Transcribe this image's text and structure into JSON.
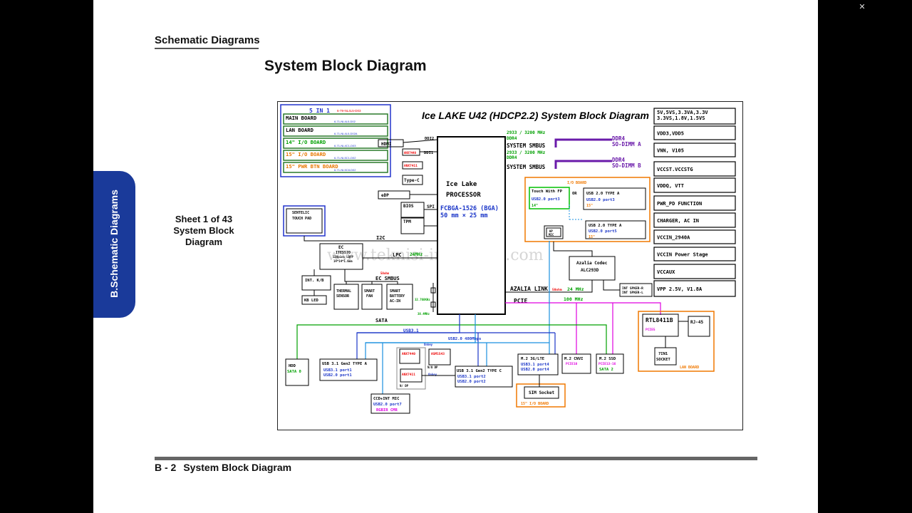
{
  "viewer": {
    "close_icon": "close-icon"
  },
  "header": {
    "section_title": "Schematic  Diagrams",
    "page_title": "System Block Diagram"
  },
  "side_tab": {
    "label": "B.Schematic Diagrams"
  },
  "sheet": {
    "line1": "Sheet 1 of 43",
    "line2": "System Block",
    "line3": "Diagram"
  },
  "footer": {
    "page_number": "B - 2",
    "title": "System Block Diagram"
  },
  "diagram": {
    "title": "Ice LAKE U42 (HDCP2.2) System Block Diagram",
    "watermark": "www.teknisi-indonesia.com",
    "boards_group": {
      "title": "5 IN 1",
      "title_pn": "6-79-NL4L5-D03",
      "rows": [
        {
          "label": "MAIN BOARD",
          "pn": "6-71-NL4L0-D02",
          "color": "#000000"
        },
        {
          "label": "LAN BOARD",
          "pn": "6-71-NL4L0-D02A",
          "color": "#000000"
        },
        {
          "label": "14\" I/O BOARD",
          "pn": "6-71-NL4C1-D03",
          "color": "#00a000"
        },
        {
          "label": "15\" I/O BOARD",
          "pn": "6-71-NL5C1-D02",
          "color": "#e87800"
        },
        {
          "label": "15\" PWR BTN BOARD",
          "pn": "6-71-NL5C8-D02",
          "color": "#e87800"
        }
      ]
    },
    "cpu": {
      "line1": "Ice Lake",
      "line2": "PROCESSOR",
      "line3": "FCBGA-1526 (BGA)",
      "line4": "50 mm × 25 mm"
    },
    "left_blocks": {
      "hdmi": "HDMI",
      "ddi2": "DDI2",
      "anx7440_small": "ANX7440",
      "ddi1": "DDI1",
      "anx7411": "ANX7411",
      "typec": "Type-C",
      "edp": "eDP",
      "bios": "BIOS",
      "spi": "SPI",
      "tpm": "TPM",
      "touchpad1": "SENTELIC",
      "touchpad2": "TOUCH PAD",
      "i2c": "I2C",
      "ec1": "EC",
      "ec2": "ITE5570",
      "ec3": "128pins LQFP",
      "ec4": "14*14*1.6mm",
      "lpc": "LPC",
      "lpc_freq": "24MHz",
      "ec_smbus": "EC SMBUS",
      "ec_smbus_small": "50ohm",
      "intkb": "INT. K/B",
      "kbled": "KB LED",
      "thermal1": "THERMAL",
      "thermal2": "SENSOR",
      "fan1": "SMART",
      "fan2": "FAN",
      "battery1": "SMART",
      "battery2": "BATTERY",
      "battery3": "AC-IN",
      "xtal1": "32.768KHz",
      "xtal2": "38.4MHz"
    },
    "memory": {
      "freq1": "2933 / 3200 MHz",
      "ddr_a_left": "DDR4",
      "smbus_a": "SYSTEM SMBUS",
      "freq2": "2933 / 3200 MHz",
      "ddr_b_left": "DDR4",
      "smbus_b": "SYSTEM SMBUS",
      "dimm_a1": "DDR4",
      "dimm_a2": "SO-DIMM A",
      "dimm_b1": "DDR4",
      "dimm_b2": "SO-DIMM B"
    },
    "io_board": {
      "title": "I/O BOARD",
      "fp1": "Touch With FP",
      "fp2": "USB2.0 port3",
      "fp3": "14\"",
      "or": "OR",
      "usb_a1_1": "USB 2.0 TYPE A",
      "usb_a1_2": "USB2.0 port3",
      "usb_a1_3": "15\"",
      "usb_a2_1": "USB 2.0 TYPE A",
      "usb_a2_2": "USB2.0 port5",
      "usb_a2_3": "15\"",
      "hpmic1": "HP",
      "hpmic2": "MIC"
    },
    "audio": {
      "codec1": "Azalia Codec",
      "codec2": "ALC293D",
      "spk1": "INT SPKER-R",
      "spk2": "INT SPKER-L",
      "azalia": "AZALIA LINK",
      "azalia_small": "50ohm",
      "azalia_freq": "24 MHz",
      "pcie": "PCIE",
      "pcie_freq": "100 MHz"
    },
    "lan": {
      "chip": "RTL8411B",
      "chip_sub": "PCIE5",
      "rj45": "RJ-45",
      "card1": "7IN1",
      "card2": "SOCKET",
      "title": "LAN BOARD"
    },
    "bottom": {
      "sata": "SATA",
      "usb31": "USB3.1",
      "usb20": "USB2.0 480Mbps",
      "hdd1": "HDD",
      "hdd2": "SATA 0",
      "usb31a1": "USB 3.1 Gen2 TYPE A",
      "usb31a2": "USB3.1 port1",
      "usb31a3": "USB2.0 port1",
      "anx7440": "ANX7440",
      "asm1543": "ASM1543",
      "onkey1": "Onkey",
      "onkey2": "Onkey",
      "anx7411b": "ANX7411",
      "ndp": "N/ DP",
      "ndp2": "N/O DP",
      "usb31c1": "USB 3.1 Gen2 TYPE C",
      "usb31c2": "USB3.1 port2",
      "usb31c3": "USB2.0 port2",
      "ccd1": "CCD+INT MIC",
      "ccd2": "USB2.0 port7",
      "ccd3": "RGBIR CMR",
      "m2_3g1": "M.2 3G/LTE",
      "m2_3g2": "USB3.1 port4",
      "m2_3g3": "USB2.0 port4",
      "m2cnvi1": "M.2 CNVI",
      "m2cnvi2": "PCIE10",
      "m2ssd1": "M.2 SSD",
      "m2ssd2": "PCIE13-16",
      "m2ssd3": "SATA 2",
      "sim": "SIM Socket",
      "sim_board": "15\" I/O BOARD"
    },
    "power_rails": [
      "5V,5VS,3.3VA,3.3V",
      "3.3VS,1.8V,1.5VS",
      "VDD3,VDD5",
      "VNN, V105",
      "VCCST.VCCSTG",
      "VDDQ, VTT",
      "PWR_PD FUNCTION",
      "CHARGER, AC IN",
      "VCCIN_2940A",
      "VCCIN Power Stage",
      "VCCAUX",
      "VPP 2.5V, V1.8A"
    ]
  }
}
